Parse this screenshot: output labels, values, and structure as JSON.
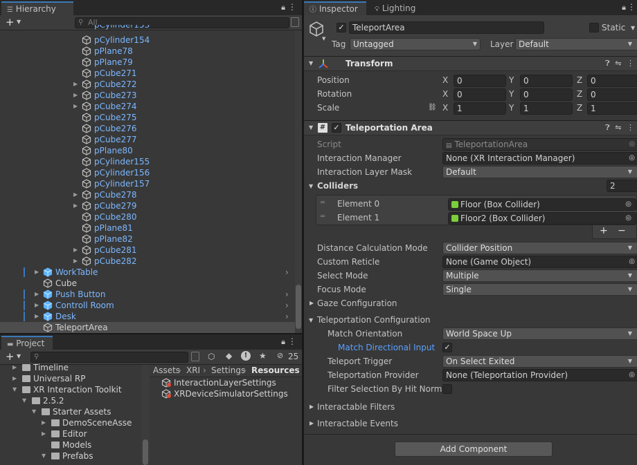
{
  "hierarchy": {
    "tab_label": "Hierarchy",
    "search_placeholder": "All",
    "add_label": "+",
    "items": [
      {
        "label": "pCylinder154",
        "indent": 2,
        "expandable": false,
        "color": "blue"
      },
      {
        "label": "pPlane78",
        "indent": 2,
        "expandable": false,
        "color": "blue"
      },
      {
        "label": "pPlane79",
        "indent": 2,
        "expandable": false,
        "color": "blue"
      },
      {
        "label": "pCube271",
        "indent": 2,
        "expandable": false,
        "color": "blue"
      },
      {
        "label": "pCube272",
        "indent": 2,
        "expandable": true,
        "color": "blue"
      },
      {
        "label": "pCube273",
        "indent": 2,
        "expandable": true,
        "color": "blue"
      },
      {
        "label": "pCube274",
        "indent": 2,
        "expandable": true,
        "color": "blue"
      },
      {
        "label": "pCube275",
        "indent": 2,
        "expandable": false,
        "color": "blue"
      },
      {
        "label": "pCube276",
        "indent": 2,
        "expandable": false,
        "color": "blue"
      },
      {
        "label": "pCube277",
        "indent": 2,
        "expandable": false,
        "color": "blue"
      },
      {
        "label": "pPlane80",
        "indent": 2,
        "expandable": false,
        "color": "blue"
      },
      {
        "label": "pCylinder155",
        "indent": 2,
        "expandable": false,
        "color": "blue"
      },
      {
        "label": "pCylinder156",
        "indent": 2,
        "expandable": false,
        "color": "blue"
      },
      {
        "label": "pCylinder157",
        "indent": 2,
        "expandable": false,
        "color": "blue"
      },
      {
        "label": "pCube278",
        "indent": 2,
        "expandable": true,
        "color": "blue"
      },
      {
        "label": "pCube279",
        "indent": 2,
        "expandable": true,
        "color": "blue"
      },
      {
        "label": "pCube280",
        "indent": 2,
        "expandable": false,
        "color": "blue"
      },
      {
        "label": "pPlane81",
        "indent": 2,
        "expandable": false,
        "color": "blue"
      },
      {
        "label": "pPlane82",
        "indent": 2,
        "expandable": false,
        "color": "blue"
      },
      {
        "label": "pCube281",
        "indent": 2,
        "expandable": true,
        "color": "blue"
      },
      {
        "label": "pCube282",
        "indent": 2,
        "expandable": true,
        "color": "blue"
      },
      {
        "label": "WorkTable",
        "indent": 0,
        "expandable": true,
        "color": "blue",
        "prefab": true,
        "chevron": true
      },
      {
        "label": "Cube",
        "indent": 0,
        "expandable": false,
        "color": "white"
      },
      {
        "label": "Push Button",
        "indent": 0,
        "expandable": true,
        "color": "blue",
        "prefab": true,
        "chevron": true
      },
      {
        "label": "Controll Room",
        "indent": 0,
        "expandable": true,
        "color": "blue",
        "prefab": true,
        "chevron": true
      },
      {
        "label": "Desk",
        "indent": 0,
        "expandable": true,
        "color": "blue",
        "prefab": true,
        "chevron": true
      },
      {
        "label": "TeleportArea",
        "indent": 0,
        "expandable": false,
        "color": "white",
        "selected": true
      }
    ]
  },
  "project": {
    "tab_label": "Project",
    "add_label": "+",
    "hidden_count": "25",
    "tree": [
      {
        "label": "Timeline",
        "indent": 1,
        "expanded": false
      },
      {
        "label": "Universal RP",
        "indent": 1,
        "expanded": false
      },
      {
        "label": "XR Interaction Toolkit",
        "indent": 1,
        "expanded": true
      },
      {
        "label": "2.5.2",
        "indent": 2,
        "expanded": true
      },
      {
        "label": "Starter Assets",
        "indent": 3,
        "expanded": true
      },
      {
        "label": "DemoSceneAsse",
        "indent": 4,
        "expanded": false
      },
      {
        "label": "Editor",
        "indent": 4,
        "expanded": false
      },
      {
        "label": "Models",
        "indent": 4,
        "expanded": null
      },
      {
        "label": "Prefabs",
        "indent": 4,
        "expanded": true
      }
    ],
    "breadcrumb": [
      "Assets",
      "XRI",
      "Settings",
      "Resources"
    ],
    "files": [
      "InteractionLayerSettings",
      "XRDeviceSimulatorSettings"
    ]
  },
  "inspector": {
    "tab_label": "Inspector",
    "lighting_tab_label": "Lighting",
    "object_name": "TeleportArea",
    "static_label": "Static",
    "tag_label": "Tag",
    "tag_value": "Untagged",
    "layer_label": "Layer",
    "layer_value": "Default",
    "transform": {
      "title": "Transform",
      "rows": [
        {
          "label": "Position",
          "x": "0",
          "y": "0",
          "z": "0"
        },
        {
          "label": "Rotation",
          "x": "0",
          "y": "0",
          "z": "0"
        },
        {
          "label": "Scale",
          "x": "1",
          "y": "1",
          "z": "1"
        }
      ],
      "axis_x": "X",
      "axis_y": "Y",
      "axis_z": "Z"
    },
    "teleportation_area": {
      "title": "Teleportation Area",
      "script_label": "Script",
      "script_value": "TeleportationArea",
      "interaction_manager_label": "Interaction Manager",
      "interaction_manager_value": "None (XR Interaction Manager)",
      "interaction_layer_mask_label": "Interaction Layer Mask",
      "interaction_layer_mask_value": "Default",
      "colliders_label": "Colliders",
      "colliders_count": "2",
      "colliders": [
        {
          "label": "Element 0",
          "value": "Floor (Box Collider)"
        },
        {
          "label": "Element 1",
          "value": "Floor2 (Box Collider)"
        }
      ],
      "add_label": "+",
      "remove_label": "−",
      "distance_mode_label": "Distance Calculation Mode",
      "distance_mode_value": "Collider Position",
      "custom_reticle_label": "Custom Reticle",
      "custom_reticle_value": "None (Game Object)",
      "select_mode_label": "Select Mode",
      "select_mode_value": "Multiple",
      "focus_mode_label": "Focus Mode",
      "focus_mode_value": "Single",
      "gaze_configuration_label": "Gaze Configuration",
      "teleportation_configuration_label": "Teleportation Configuration",
      "match_orientation_label": "Match Orientation",
      "match_orientation_value": "World Space Up",
      "match_directional_input_label": "Match Directional Input",
      "match_directional_input_checked": true,
      "teleport_trigger_label": "Teleport Trigger",
      "teleport_trigger_value": "On Select Exited",
      "teleportation_provider_label": "Teleportation Provider",
      "teleportation_provider_value": "None (Teleportation Provider)",
      "filter_selection_label": "Filter Selection By Hit Normal",
      "interactable_filters_label": "Interactable Filters",
      "interactable_events_label": "Interactable Events"
    },
    "add_component_label": "Add Component"
  },
  "colors": {
    "accent": "#3a79bb",
    "prefab_blue": "#7cb8ff",
    "selected_row": "#4d4d4d",
    "panel_bg": "#383838",
    "tab_bg": "#282828"
  }
}
